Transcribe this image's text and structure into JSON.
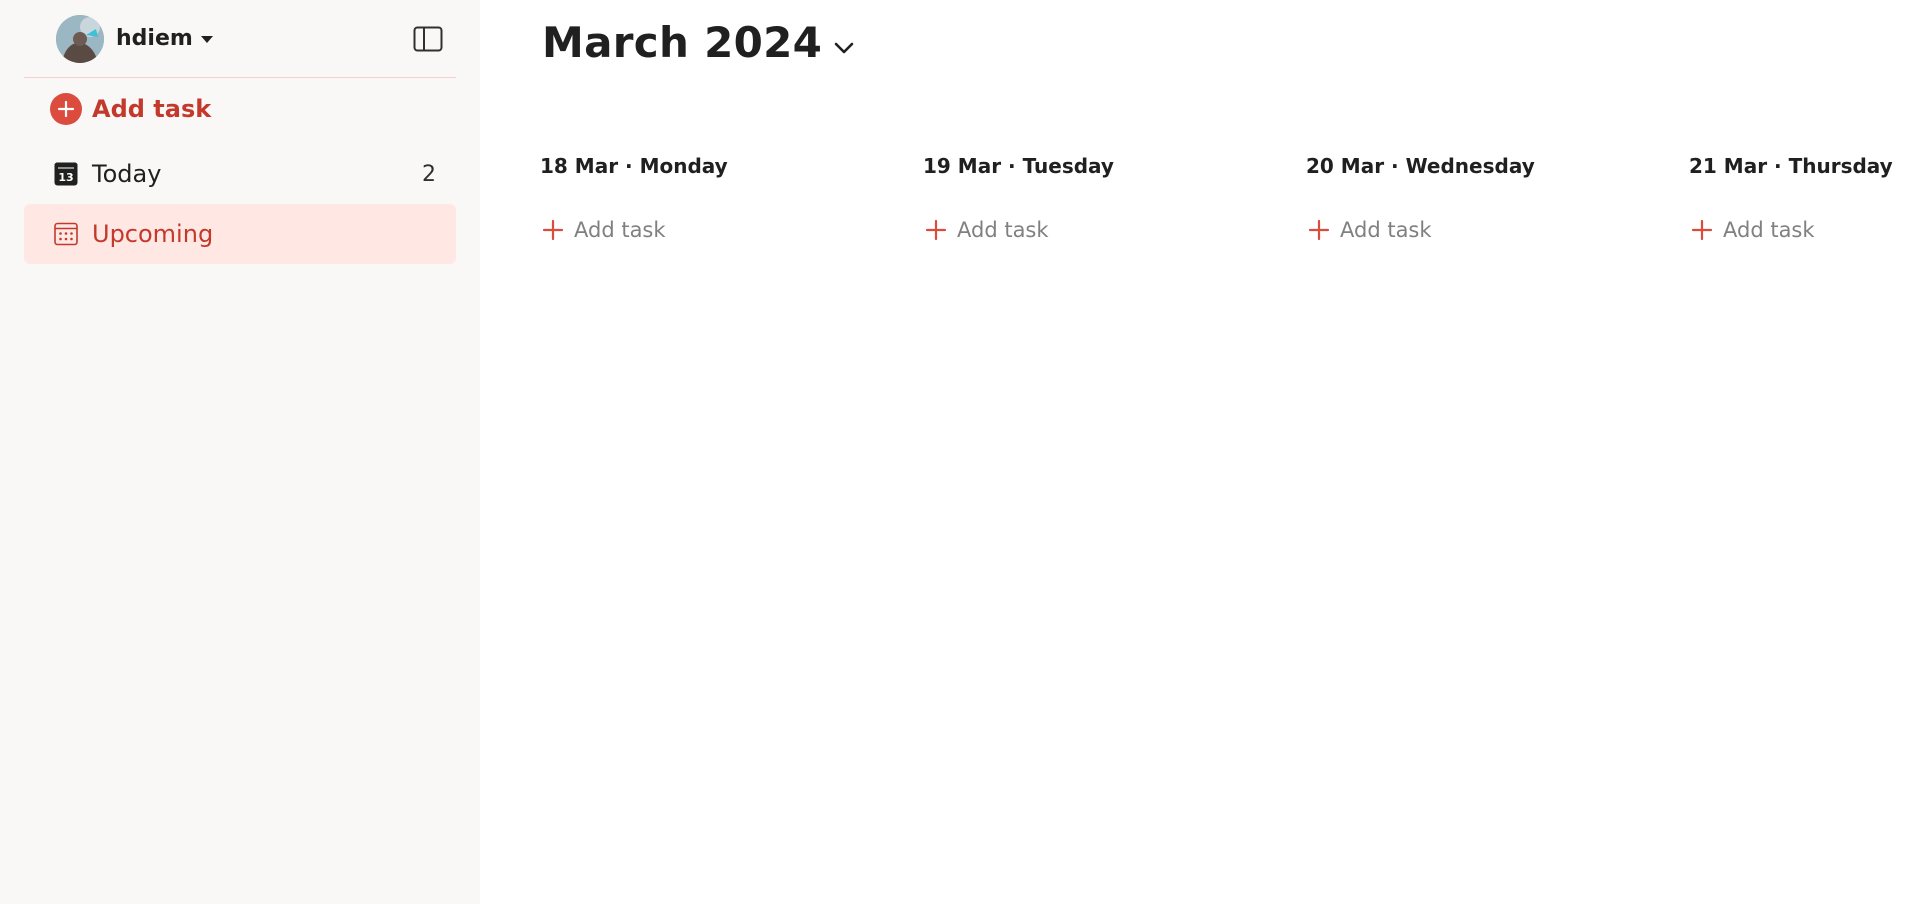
{
  "sidebar": {
    "username": "hdiem",
    "add_task_label": "Add task",
    "items": [
      {
        "label": "Today",
        "count": "2",
        "icon": "calendar-today-icon",
        "date_badge": "13"
      },
      {
        "label": "Upcoming",
        "icon": "calendar-upcoming-icon",
        "active": true
      }
    ]
  },
  "main": {
    "month_title": "March 2024",
    "days": [
      {
        "title": "18 Mar · Monday",
        "add_label": "Add task"
      },
      {
        "title": "19 Mar · Tuesday",
        "add_label": "Add task"
      },
      {
        "title": "20 Mar · Wednesday",
        "add_label": "Add task"
      },
      {
        "title": "21 Mar · Thursday",
        "add_label": "Add task"
      }
    ]
  },
  "colors": {
    "accent": "#dc4c3e",
    "accent_text": "#c3392c",
    "active_bg": "#ffe7e3",
    "sidebar_bg": "#faf8f7"
  }
}
